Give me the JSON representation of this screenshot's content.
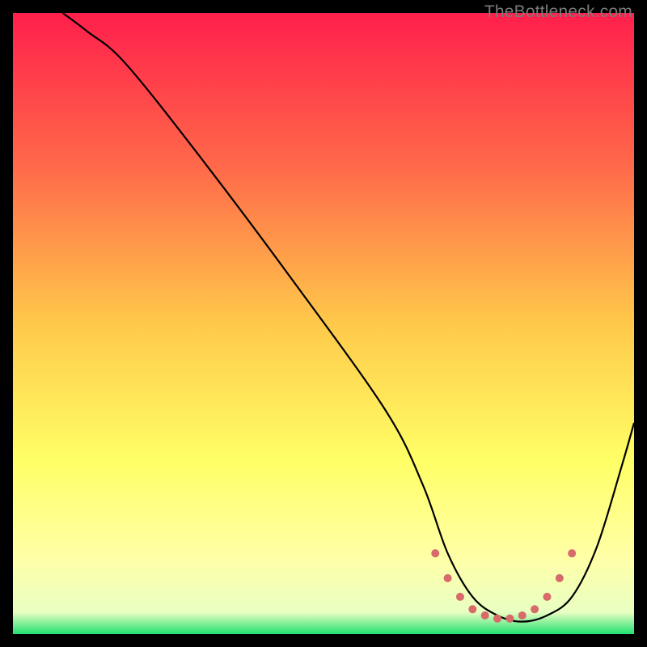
{
  "watermark": "TheBottleneck.com",
  "chart_data": {
    "type": "line",
    "title": "",
    "xlabel": "",
    "ylabel": "",
    "xlim": [
      0,
      100
    ],
    "ylim": [
      0,
      100
    ],
    "background_gradient": {
      "stops": [
        {
          "offset": 0.0,
          "color": "#ff1f4b"
        },
        {
          "offset": 0.25,
          "color": "#ff6a4a"
        },
        {
          "offset": 0.5,
          "color": "#ffc94a"
        },
        {
          "offset": 0.72,
          "color": "#ffff66"
        },
        {
          "offset": 0.88,
          "color": "#ffffa8"
        },
        {
          "offset": 0.965,
          "color": "#e8ffc2"
        },
        {
          "offset": 1.0,
          "color": "#20e070"
        }
      ]
    },
    "series": [
      {
        "name": "bottleneck-curve",
        "color": "#000000",
        "x": [
          8,
          12,
          18,
          30,
          45,
          60,
          66,
          70,
          74,
          78,
          82,
          86,
          90,
          94,
          98,
          100
        ],
        "y": [
          100,
          97,
          92,
          77,
          57,
          36,
          24,
          13,
          6,
          3,
          2,
          3,
          6,
          14,
          27,
          34
        ]
      }
    ],
    "plateau_markers": {
      "name": "optimal-range-dots",
      "color": "#d86a6a",
      "radius": 5,
      "x": [
        68,
        70,
        72,
        74,
        76,
        78,
        80,
        82,
        84,
        86,
        88,
        90
      ],
      "y": [
        13,
        9,
        6,
        4,
        3,
        2.5,
        2.5,
        3,
        4,
        6,
        9,
        13
      ]
    }
  }
}
